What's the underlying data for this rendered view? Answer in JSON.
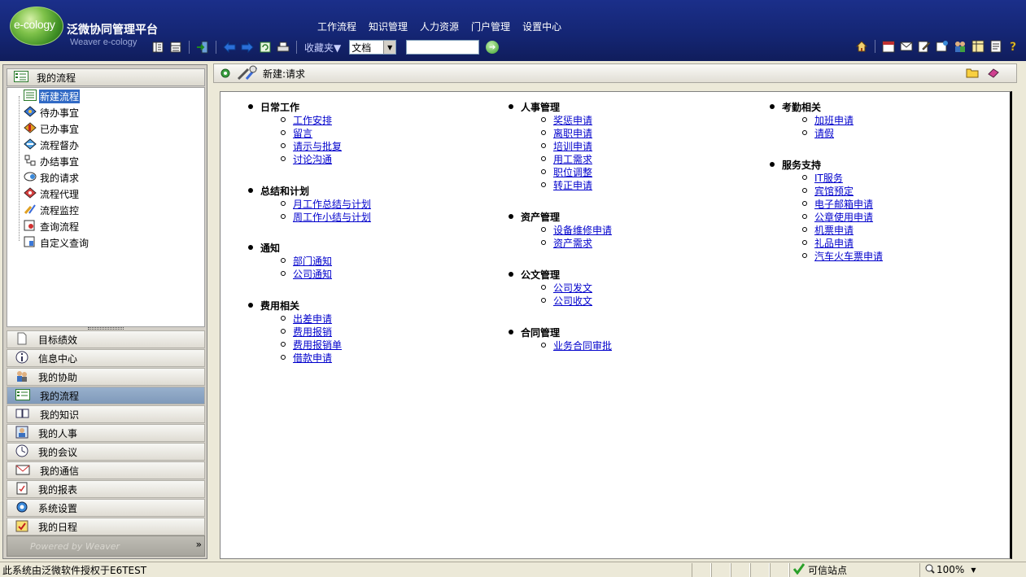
{
  "brand": {
    "logo_text": "e-cology",
    "title": "泛微协同管理平台",
    "subtitle": "Weaver e-cology"
  },
  "top_nav": [
    "工作流程",
    "知识管理",
    "人力资源",
    "门户管理",
    "设置中心"
  ],
  "toolbar": {
    "favorites_label": "收藏夹▼",
    "doc_select_value": "文档",
    "search_value": ""
  },
  "left_panel": {
    "header": "我的流程",
    "tree": [
      {
        "label": "新建流程",
        "icon": "new-flow-icon",
        "selected": true
      },
      {
        "label": "待办事宜",
        "icon": "todo-icon"
      },
      {
        "label": "已办事宜",
        "icon": "done-icon"
      },
      {
        "label": "流程督办",
        "icon": "supervise-icon"
      },
      {
        "label": "办结事宜",
        "icon": "finished-icon"
      },
      {
        "label": "我的请求",
        "icon": "my-request-icon"
      },
      {
        "label": "流程代理",
        "icon": "agent-icon"
      },
      {
        "label": "流程监控",
        "icon": "monitor-icon"
      },
      {
        "label": "查询流程",
        "icon": "query-flow-icon"
      },
      {
        "label": "自定义查询",
        "icon": "custom-query-icon"
      }
    ],
    "menu": [
      {
        "label": "目标绩效",
        "icon": "document-icon"
      },
      {
        "label": "信息中心",
        "icon": "info-icon"
      },
      {
        "label": "我的协助",
        "icon": "people-icon"
      },
      {
        "label": "我的流程",
        "icon": "list-icon",
        "active": true
      },
      {
        "label": "我的知识",
        "icon": "book-icon"
      },
      {
        "label": "我的人事",
        "icon": "person-icon"
      },
      {
        "label": "我的会议",
        "icon": "meeting-icon"
      },
      {
        "label": "我的通信",
        "icon": "mail-icon"
      },
      {
        "label": "我的报表",
        "icon": "report-icon"
      },
      {
        "label": "系统设置",
        "icon": "settings-icon"
      },
      {
        "label": "我的日程",
        "icon": "calendar-icon"
      }
    ],
    "powered": "Powered by Weaver",
    "collapse": "»"
  },
  "content_header": {
    "title": "新建:请求"
  },
  "columns": [
    [
      {
        "title": "日常工作",
        "items": [
          "工作安排",
          "留言",
          "请示与批复",
          "讨论沟通"
        ]
      },
      {
        "title": "总结和计划",
        "items": [
          "月工作总结与计划",
          "周工作小结与计划"
        ]
      },
      {
        "title": "通知",
        "items": [
          "部门通知",
          "公司通知"
        ]
      },
      {
        "title": "费用相关",
        "items": [
          "出差申请",
          "费用报销",
          "费用报销单",
          "借款申请"
        ]
      }
    ],
    [
      {
        "title": "人事管理",
        "items": [
          "奖惩申请",
          "离职申请",
          "培训申请",
          "用工需求",
          "职位调整",
          "转正申请"
        ]
      },
      {
        "title": "资产管理",
        "items": [
          "设备维修申请",
          "资产需求"
        ]
      },
      {
        "title": "公文管理",
        "items": [
          "公司发文",
          "公司收文"
        ]
      },
      {
        "title": "合同管理",
        "items": [
          "业务合同审批"
        ]
      }
    ],
    [
      {
        "title": "考勤相关",
        "items": [
          "加班申请",
          "请假"
        ]
      },
      {
        "title": "服务支持",
        "items": [
          "IT服务",
          "宾馆预定",
          "电子邮箱申请",
          "公章使用申请",
          "机票申请",
          "礼品申请",
          "汽车火车票申请"
        ]
      }
    ]
  ],
  "statusbar": {
    "text": "此系统由泛微软件授权于E6TEST",
    "zone": "可信站点",
    "zoom": "100%"
  }
}
